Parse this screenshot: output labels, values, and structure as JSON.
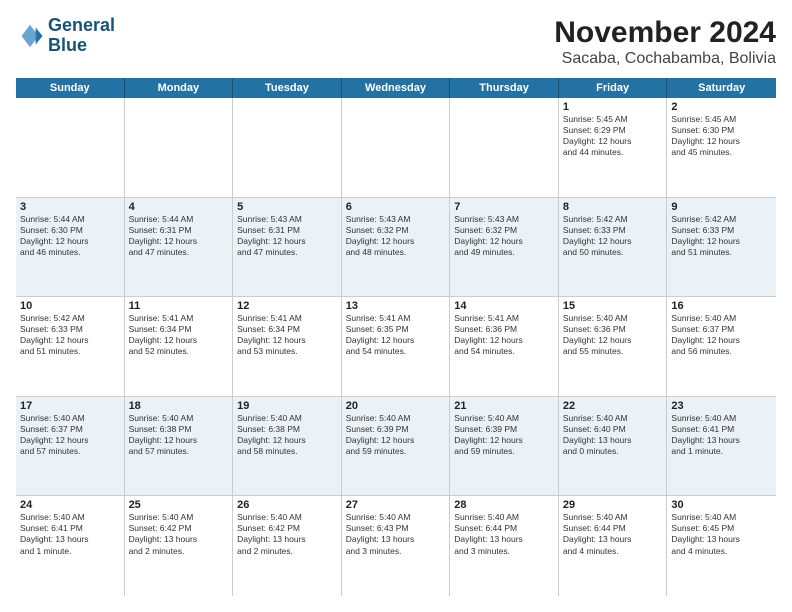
{
  "logo": {
    "line1": "General",
    "line2": "Blue"
  },
  "title": "November 2024",
  "subtitle": "Sacaba, Cochabamba, Bolivia",
  "weekdays": [
    "Sunday",
    "Monday",
    "Tuesday",
    "Wednesday",
    "Thursday",
    "Friday",
    "Saturday"
  ],
  "rows": [
    [
      {
        "day": "",
        "info": ""
      },
      {
        "day": "",
        "info": ""
      },
      {
        "day": "",
        "info": ""
      },
      {
        "day": "",
        "info": ""
      },
      {
        "day": "",
        "info": ""
      },
      {
        "day": "1",
        "info": "Sunrise: 5:45 AM\nSunset: 6:29 PM\nDaylight: 12 hours\nand 44 minutes."
      },
      {
        "day": "2",
        "info": "Sunrise: 5:45 AM\nSunset: 6:30 PM\nDaylight: 12 hours\nand 45 minutes."
      }
    ],
    [
      {
        "day": "3",
        "info": "Sunrise: 5:44 AM\nSunset: 6:30 PM\nDaylight: 12 hours\nand 46 minutes."
      },
      {
        "day": "4",
        "info": "Sunrise: 5:44 AM\nSunset: 6:31 PM\nDaylight: 12 hours\nand 47 minutes."
      },
      {
        "day": "5",
        "info": "Sunrise: 5:43 AM\nSunset: 6:31 PM\nDaylight: 12 hours\nand 47 minutes."
      },
      {
        "day": "6",
        "info": "Sunrise: 5:43 AM\nSunset: 6:32 PM\nDaylight: 12 hours\nand 48 minutes."
      },
      {
        "day": "7",
        "info": "Sunrise: 5:43 AM\nSunset: 6:32 PM\nDaylight: 12 hours\nand 49 minutes."
      },
      {
        "day": "8",
        "info": "Sunrise: 5:42 AM\nSunset: 6:33 PM\nDaylight: 12 hours\nand 50 minutes."
      },
      {
        "day": "9",
        "info": "Sunrise: 5:42 AM\nSunset: 6:33 PM\nDaylight: 12 hours\nand 51 minutes."
      }
    ],
    [
      {
        "day": "10",
        "info": "Sunrise: 5:42 AM\nSunset: 6:33 PM\nDaylight: 12 hours\nand 51 minutes."
      },
      {
        "day": "11",
        "info": "Sunrise: 5:41 AM\nSunset: 6:34 PM\nDaylight: 12 hours\nand 52 minutes."
      },
      {
        "day": "12",
        "info": "Sunrise: 5:41 AM\nSunset: 6:34 PM\nDaylight: 12 hours\nand 53 minutes."
      },
      {
        "day": "13",
        "info": "Sunrise: 5:41 AM\nSunset: 6:35 PM\nDaylight: 12 hours\nand 54 minutes."
      },
      {
        "day": "14",
        "info": "Sunrise: 5:41 AM\nSunset: 6:36 PM\nDaylight: 12 hours\nand 54 minutes."
      },
      {
        "day": "15",
        "info": "Sunrise: 5:40 AM\nSunset: 6:36 PM\nDaylight: 12 hours\nand 55 minutes."
      },
      {
        "day": "16",
        "info": "Sunrise: 5:40 AM\nSunset: 6:37 PM\nDaylight: 12 hours\nand 56 minutes."
      }
    ],
    [
      {
        "day": "17",
        "info": "Sunrise: 5:40 AM\nSunset: 6:37 PM\nDaylight: 12 hours\nand 57 minutes."
      },
      {
        "day": "18",
        "info": "Sunrise: 5:40 AM\nSunset: 6:38 PM\nDaylight: 12 hours\nand 57 minutes."
      },
      {
        "day": "19",
        "info": "Sunrise: 5:40 AM\nSunset: 6:38 PM\nDaylight: 12 hours\nand 58 minutes."
      },
      {
        "day": "20",
        "info": "Sunrise: 5:40 AM\nSunset: 6:39 PM\nDaylight: 12 hours\nand 59 minutes."
      },
      {
        "day": "21",
        "info": "Sunrise: 5:40 AM\nSunset: 6:39 PM\nDaylight: 12 hours\nand 59 minutes."
      },
      {
        "day": "22",
        "info": "Sunrise: 5:40 AM\nSunset: 6:40 PM\nDaylight: 13 hours\nand 0 minutes."
      },
      {
        "day": "23",
        "info": "Sunrise: 5:40 AM\nSunset: 6:41 PM\nDaylight: 13 hours\nand 1 minute."
      }
    ],
    [
      {
        "day": "24",
        "info": "Sunrise: 5:40 AM\nSunset: 6:41 PM\nDaylight: 13 hours\nand 1 minute."
      },
      {
        "day": "25",
        "info": "Sunrise: 5:40 AM\nSunset: 6:42 PM\nDaylight: 13 hours\nand 2 minutes."
      },
      {
        "day": "26",
        "info": "Sunrise: 5:40 AM\nSunset: 6:42 PM\nDaylight: 13 hours\nand 2 minutes."
      },
      {
        "day": "27",
        "info": "Sunrise: 5:40 AM\nSunset: 6:43 PM\nDaylight: 13 hours\nand 3 minutes."
      },
      {
        "day": "28",
        "info": "Sunrise: 5:40 AM\nSunset: 6:44 PM\nDaylight: 13 hours\nand 3 minutes."
      },
      {
        "day": "29",
        "info": "Sunrise: 5:40 AM\nSunset: 6:44 PM\nDaylight: 13 hours\nand 4 minutes."
      },
      {
        "day": "30",
        "info": "Sunrise: 5:40 AM\nSunset: 6:45 PM\nDaylight: 13 hours\nand 4 minutes."
      }
    ]
  ]
}
